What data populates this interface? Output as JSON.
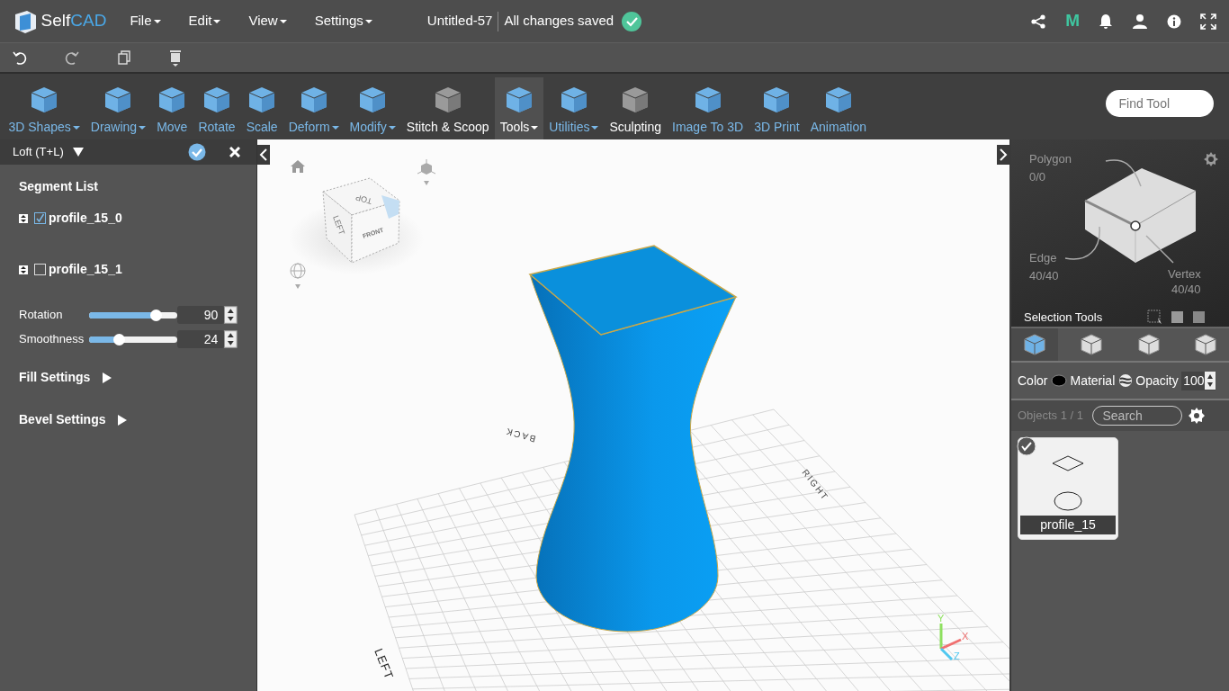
{
  "topbar": {
    "logo": {
      "first": "Self",
      "second": "CAD"
    },
    "menus": [
      {
        "label": "File"
      },
      {
        "label": "Edit"
      },
      {
        "label": "View"
      },
      {
        "label": "Settings"
      }
    ],
    "document": {
      "title": "Untitled-57",
      "status": "All changes saved",
      "saved": true
    },
    "brand_letter": "M"
  },
  "ribbon": {
    "tools": [
      {
        "label": "3D Shapes",
        "dropdown": true,
        "selected": false,
        "kind": "standard"
      },
      {
        "label": "Drawing",
        "dropdown": true,
        "selected": false,
        "kind": "standard"
      },
      {
        "label": "Move",
        "dropdown": false,
        "selected": false,
        "kind": "standard"
      },
      {
        "label": "Rotate",
        "dropdown": false,
        "selected": false,
        "kind": "standard"
      },
      {
        "label": "Scale",
        "dropdown": false,
        "selected": false,
        "kind": "standard"
      },
      {
        "label": "Deform",
        "dropdown": true,
        "selected": false,
        "kind": "standard"
      },
      {
        "label": "Modify",
        "dropdown": true,
        "selected": false,
        "kind": "standard"
      },
      {
        "label": "Stitch & Scoop",
        "dropdown": false,
        "selected": false,
        "kind": "plugin"
      },
      {
        "label": "Tools",
        "dropdown": true,
        "selected": true,
        "kind": "standard"
      },
      {
        "label": "Utilities",
        "dropdown": true,
        "selected": false,
        "kind": "standard"
      },
      {
        "label": "Sculpting",
        "dropdown": false,
        "selected": false,
        "kind": "plugin"
      },
      {
        "label": "Image To 3D",
        "dropdown": false,
        "selected": false,
        "kind": "standard"
      },
      {
        "label": "3D Print",
        "dropdown": false,
        "selected": false,
        "kind": "standard"
      },
      {
        "label": "Animation",
        "dropdown": false,
        "selected": false,
        "kind": "standard"
      }
    ],
    "search": {
      "placeholder": "Find Tool"
    }
  },
  "tool_panel": {
    "title": "Loft (T+L)",
    "heading": "Segment List",
    "segments": [
      {
        "name": "profile_15_0",
        "checked": true
      },
      {
        "name": "profile_15_1",
        "checked": false
      }
    ],
    "sliders": [
      {
        "label": "Rotation",
        "level": 0.76,
        "value": "90"
      },
      {
        "label": "Smoothness",
        "level": 0.34,
        "value": "24"
      }
    ],
    "sections": [
      {
        "label": "Fill Settings",
        "expanded": false
      },
      {
        "label": "Bevel Settings",
        "expanded": false
      }
    ]
  },
  "viewport": {
    "cube_faces": [
      "TOP",
      "LEFT",
      "FRONT"
    ],
    "floor_labels": [
      "BACK",
      "RIGHT",
      "LEFT"
    ],
    "axes": [
      "Y",
      "X",
      "Z"
    ]
  },
  "selection_panel": {
    "polygon": {
      "label": "Polygon",
      "count": "0/0"
    },
    "edge": {
      "label": "Edge",
      "count": "40/40"
    },
    "vertex": {
      "label": "Vertex",
      "count": "40/40"
    },
    "tools_label": "Selection Tools",
    "modes": [
      {
        "selected": true
      },
      {
        "selected": false
      },
      {
        "selected": false
      },
      {
        "selected": false
      }
    ]
  },
  "properties": {
    "color_label": "Color",
    "material_label": "Material",
    "opacity_label": "Opacity",
    "opacity_value": "100"
  },
  "objects": {
    "count": "Objects 1 / 1",
    "search_placeholder": "Search",
    "items": [
      {
        "name": "profile_15",
        "selected": true
      }
    ]
  }
}
